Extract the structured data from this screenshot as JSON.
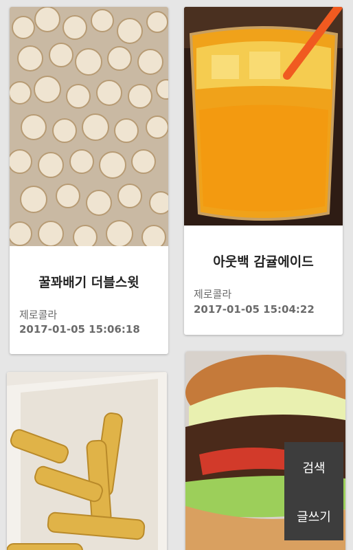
{
  "posts": [
    {
      "title": "꿀꽈배기 더블스윗",
      "author": "제로콜라",
      "date": "2017-01-05 15:06:18",
      "image": "honey-twist-snack-photo"
    },
    {
      "title": "아웃백 감귤에이드",
      "author": "제로콜라",
      "date": "2017-01-05 15:04:22",
      "image": "tangerine-ade-drink-photo"
    },
    {
      "image": "fried-cheese-sticks-photo"
    },
    {
      "image": "hamburger-photo"
    }
  ],
  "actions": {
    "search_label": "검색",
    "write_label": "글쓰기"
  }
}
